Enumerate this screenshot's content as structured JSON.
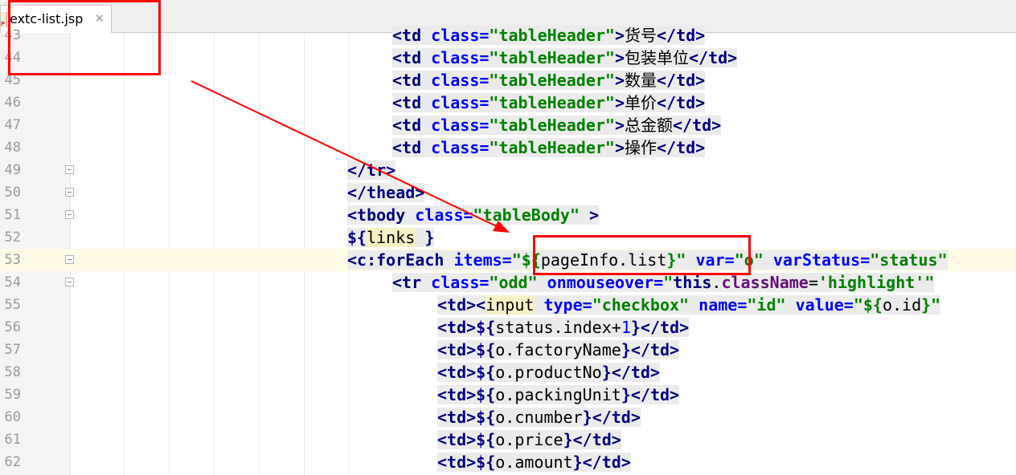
{
  "tab": {
    "file_badge": "P",
    "title": "extc-list.jsp",
    "close_glyph": "×"
  },
  "annotation": {
    "box_color": "#ff0000",
    "arrow_color": "#ff0000"
  },
  "lines": [
    {
      "num": "43",
      "indent": 7,
      "tokens": [
        [
          "tag",
          "<td "
        ],
        [
          "attr",
          "class="
        ],
        [
          "val",
          "\"tableHeader\""
        ],
        [
          "tag",
          ">"
        ],
        [
          "dark",
          "货号"
        ],
        [
          "tag",
          "</td>"
        ]
      ]
    },
    {
      "num": "44",
      "indent": 7,
      "tokens": [
        [
          "tag",
          "<td "
        ],
        [
          "attr",
          "class="
        ],
        [
          "val",
          "\"tableHeader\""
        ],
        [
          "tag",
          ">"
        ],
        [
          "dark",
          "包装单位"
        ],
        [
          "tag",
          "</td>"
        ]
      ]
    },
    {
      "num": "45",
      "indent": 7,
      "tokens": [
        [
          "tag",
          "<td "
        ],
        [
          "attr",
          "class="
        ],
        [
          "val",
          "\"tableHeader\""
        ],
        [
          "tag",
          ">"
        ],
        [
          "dark",
          "数量"
        ],
        [
          "tag",
          "</td>"
        ]
      ]
    },
    {
      "num": "46",
      "indent": 7,
      "tokens": [
        [
          "tag",
          "<td "
        ],
        [
          "attr",
          "class="
        ],
        [
          "val",
          "\"tableHeader\""
        ],
        [
          "tag",
          ">"
        ],
        [
          "dark",
          "单价"
        ],
        [
          "tag",
          "</td>"
        ]
      ]
    },
    {
      "num": "47",
      "indent": 7,
      "tokens": [
        [
          "tag",
          "<td "
        ],
        [
          "attr",
          "class="
        ],
        [
          "val",
          "\"tableHeader\""
        ],
        [
          "tag",
          ">"
        ],
        [
          "dark",
          "总金额"
        ],
        [
          "tag",
          "</td>"
        ]
      ]
    },
    {
      "num": "48",
      "indent": 7,
      "tokens": [
        [
          "tag",
          "<td "
        ],
        [
          "attr",
          "class="
        ],
        [
          "val",
          "\"tableHeader\""
        ],
        [
          "tag",
          ">"
        ],
        [
          "dark",
          "操作"
        ],
        [
          "tag",
          "</td>"
        ]
      ]
    },
    {
      "num": "49",
      "indent": 6,
      "fold": true,
      "tokens": [
        [
          "tag",
          "</tr>"
        ]
      ]
    },
    {
      "num": "50",
      "indent": 6,
      "fold": true,
      "tokens": [
        [
          "tag",
          "</thead>"
        ]
      ]
    },
    {
      "num": "51",
      "indent": 6,
      "fold": true,
      "tokens": [
        [
          "tag",
          "<tbody "
        ],
        [
          "attr",
          "class="
        ],
        [
          "val",
          "\"tableBody\""
        ],
        [
          "tag",
          " >"
        ]
      ]
    },
    {
      "num": "52",
      "indent": 6,
      "tokens": [
        [
          "kw",
          "${"
        ],
        [
          "yl",
          "links"
        ],
        [
          "kw",
          " }"
        ]
      ]
    },
    {
      "num": "53",
      "indent": 6,
      "fold": true,
      "current": true,
      "tokens": [
        [
          "tag",
          "<c:forEach "
        ],
        [
          "attr",
          "items="
        ],
        [
          "val",
          "\"${"
        ],
        [
          "el",
          "pageInfo.list"
        ],
        [
          "val",
          "}\""
        ],
        [
          "attr",
          " var="
        ],
        [
          "val",
          "\"o\""
        ],
        [
          "attr",
          " varStatus="
        ],
        [
          "val",
          "\"status\""
        ]
      ]
    },
    {
      "num": "54",
      "indent": 7,
      "fold": true,
      "tokens": [
        [
          "tag",
          "<tr "
        ],
        [
          "attr",
          "class="
        ],
        [
          "val",
          "\"odd\""
        ],
        [
          "attr",
          " onmouseover="
        ],
        [
          "val",
          "\""
        ],
        [
          "kw",
          "this"
        ],
        [
          "dark",
          "."
        ],
        [
          "prop",
          "className"
        ],
        [
          "dark",
          "="
        ],
        [
          "val",
          "'highlight'\""
        ]
      ]
    },
    {
      "num": "55",
      "indent": 8,
      "tokens": [
        [
          "tag",
          "<td><"
        ],
        [
          "yl",
          "input"
        ],
        [
          "attr",
          " type="
        ],
        [
          "val",
          "\"checkbox\""
        ],
        [
          "attr",
          " name="
        ],
        [
          "val",
          "\"id\""
        ],
        [
          "attr",
          " value="
        ],
        [
          "val",
          "\"${"
        ],
        [
          "el",
          "o.id"
        ],
        [
          "val",
          "}\""
        ]
      ]
    },
    {
      "num": "56",
      "indent": 8,
      "tokens": [
        [
          "tag",
          "<td>"
        ],
        [
          "kw",
          "${"
        ],
        [
          "el",
          "status.index+"
        ],
        [
          "num",
          "1"
        ],
        [
          "kw",
          "}"
        ],
        [
          "tag",
          "</td>"
        ]
      ]
    },
    {
      "num": "57",
      "indent": 8,
      "tokens": [
        [
          "tag",
          "<td>"
        ],
        [
          "kw",
          "${"
        ],
        [
          "el",
          "o.factoryName"
        ],
        [
          "kw",
          "}"
        ],
        [
          "tag",
          "</td>"
        ]
      ]
    },
    {
      "num": "58",
      "indent": 8,
      "tokens": [
        [
          "tag",
          "<td>"
        ],
        [
          "kw",
          "${"
        ],
        [
          "el",
          "o.productNo"
        ],
        [
          "kw",
          "}"
        ],
        [
          "tag",
          "</td>"
        ]
      ]
    },
    {
      "num": "59",
      "indent": 8,
      "tokens": [
        [
          "tag",
          "<td>"
        ],
        [
          "kw",
          "${"
        ],
        [
          "el",
          "o.packingUnit"
        ],
        [
          "kw",
          "}"
        ],
        [
          "tag",
          "</td>"
        ]
      ]
    },
    {
      "num": "60",
      "indent": 8,
      "tokens": [
        [
          "tag",
          "<td>"
        ],
        [
          "kw",
          "${"
        ],
        [
          "el",
          "o.cnumber"
        ],
        [
          "kw",
          "}"
        ],
        [
          "tag",
          "</td>"
        ]
      ]
    },
    {
      "num": "61",
      "indent": 8,
      "tokens": [
        [
          "tag",
          "<td>"
        ],
        [
          "kw",
          "${"
        ],
        [
          "el",
          "o.price"
        ],
        [
          "kw",
          "}"
        ],
        [
          "tag",
          "</td>"
        ]
      ]
    },
    {
      "num": "62",
      "indent": 8,
      "tokens": [
        [
          "tag",
          "<td>"
        ],
        [
          "kw",
          "${"
        ],
        [
          "el",
          "o.amount"
        ],
        [
          "kw",
          "}"
        ],
        [
          "tag",
          "</td>"
        ]
      ]
    }
  ]
}
